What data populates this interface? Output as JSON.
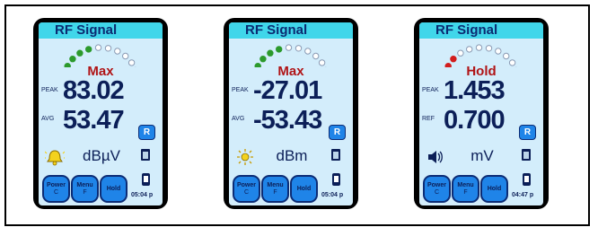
{
  "screenshot_caption": "",
  "devices": [
    {
      "title": "RF Signal",
      "mode": "Max",
      "row1": {
        "label": "PEAK",
        "value": "83.02"
      },
      "row2": {
        "label": "AVG",
        "value": "53.47"
      },
      "r_button": "R",
      "unit": "dBµV",
      "status_icon": "bell-icon",
      "buttons": [
        {
          "label": "Power",
          "sub": "C"
        },
        {
          "label": "Menu",
          "sub": "F"
        },
        {
          "label": "Hold",
          "sub": ""
        }
      ],
      "time": "05:04 p",
      "meter": {
        "lit_dots": 5,
        "total_dots": 11,
        "lit_color": "#2c9a2c"
      }
    },
    {
      "title": "RF Signal",
      "mode": "Max",
      "row1": {
        "label": "PEAK",
        "value": "-27.01"
      },
      "row2": {
        "label": "AVG",
        "value": "-53.43"
      },
      "r_button": "R",
      "unit": "dBm",
      "status_icon": "sun-icon",
      "buttons": [
        {
          "label": "Power",
          "sub": "C"
        },
        {
          "label": "Menu",
          "sub": "F"
        },
        {
          "label": "Hold",
          "sub": ""
        }
      ],
      "time": "05:04 p",
      "meter": {
        "lit_dots": 5,
        "total_dots": 11,
        "lit_color": "#2c9a2c"
      }
    },
    {
      "title": "RF Signal",
      "mode": "Hold",
      "row1": {
        "label": "PEAK",
        "value": "1.453"
      },
      "row2": {
        "label": "REF",
        "value": "0.700"
      },
      "r_button": "R",
      "unit": "mV",
      "status_icon": "speaker-icon",
      "buttons": [
        {
          "label": "Power",
          "sub": "C"
        },
        {
          "label": "Menu",
          "sub": "F"
        },
        {
          "label": "Hold",
          "sub": ""
        }
      ],
      "time": "04:47 p",
      "meter": {
        "lit_dots": 3,
        "total_dots": 11,
        "lit_color": "#d21d1d"
      }
    }
  ]
}
